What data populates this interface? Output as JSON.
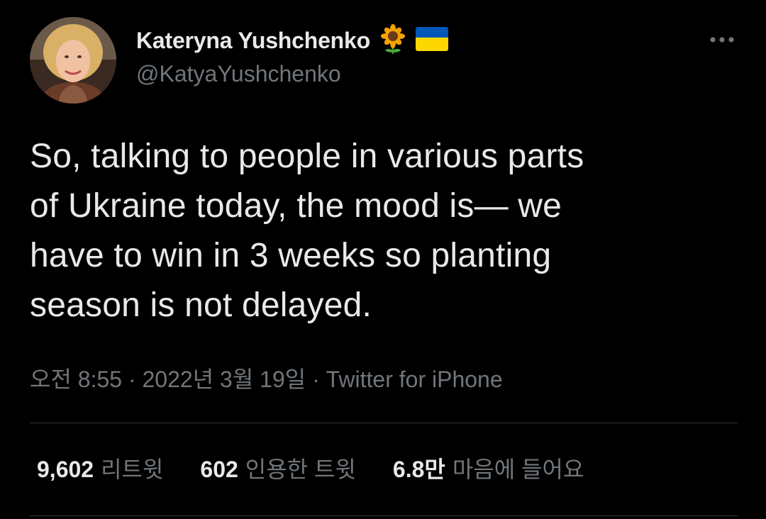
{
  "author": {
    "display_name": "Kateryna Yushchenko",
    "handle": "@KatyaYushchenko",
    "badges": [
      "sunflower-emoji",
      "ukraine-flag-emoji"
    ]
  },
  "menu": {
    "icon": "more-icon"
  },
  "tweet": {
    "text": "So, talking to people in various parts\nof Ukraine today, the mood is— we\nhave to win in 3 weeks so planting\nseason is not delayed."
  },
  "meta": {
    "time": "오전 8:55",
    "separator": " · ",
    "date": "2022년 3월 19일",
    "source": "Twitter for iPhone"
  },
  "stats": {
    "retweets": {
      "count": "9,602",
      "label": "리트윗"
    },
    "quotes": {
      "count": "602",
      "label": "인용한 트윗"
    },
    "likes": {
      "count": "6.8만",
      "label": "마음에 들어요"
    }
  },
  "colors": {
    "background": "#000000",
    "text_primary": "#e7e9ea",
    "text_secondary": "#71767b",
    "divider": "#2f3336",
    "flag_blue": "#0057b7",
    "flag_yellow": "#ffd700"
  }
}
